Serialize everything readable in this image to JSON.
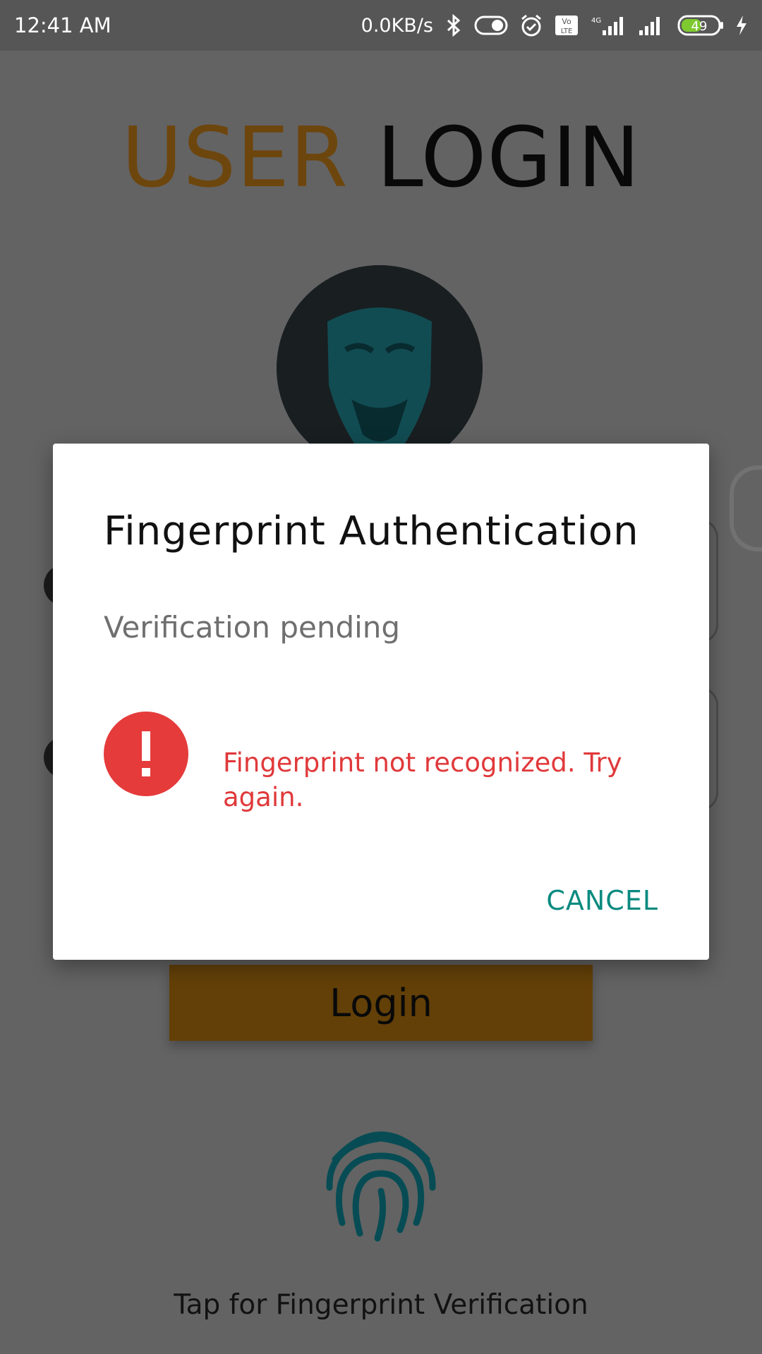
{
  "status_bar": {
    "time": "12:41 AM",
    "network_speed": "0.0KB/s",
    "battery_level": "49",
    "icons": [
      "bluetooth-icon",
      "toggle-icon",
      "alarm-icon",
      "volte-icon",
      "signal-4g-icon",
      "signal-icon",
      "battery-icon",
      "charging-icon"
    ]
  },
  "screen": {
    "title_part1": "USER",
    "title_part2": "LOGIN",
    "login_button": "Login",
    "fingerprint_caption": "Tap for Fingerprint Verification"
  },
  "dialog": {
    "title": "Fingerprint Authentication",
    "description": "Verification pending",
    "error_message": "Fingerprint not recognized. Try again.",
    "cancel_button": "CANCEL"
  },
  "colors": {
    "accent_orange": "#c7801a",
    "teal": "#0a8a80",
    "error_red": "#e0393b"
  }
}
